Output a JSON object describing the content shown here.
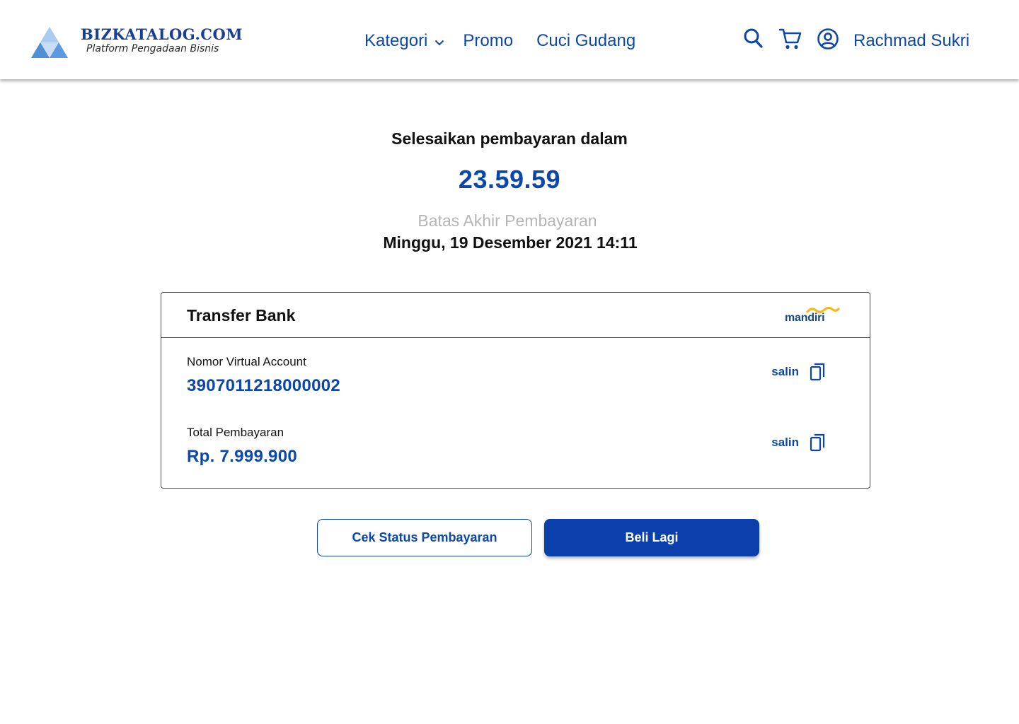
{
  "brand": {
    "name": "BIZKATALOG.COM",
    "tagline": "Platform Pengadaan Bisnis"
  },
  "nav": {
    "items": [
      {
        "label": "Kategori",
        "has_dropdown": true
      },
      {
        "label": "Promo"
      },
      {
        "label": "Cuci Gudang"
      }
    ]
  },
  "header": {
    "icons": [
      "search-icon",
      "cart-icon",
      "user-icon"
    ],
    "username": "Rachmad Sukri"
  },
  "payment": {
    "countdown_title": "Selesaikan pembayaran dalam",
    "timer": "23.59.59",
    "deadline_label": "Batas Akhir Pembayaran",
    "deadline_value": "Minggu, 19 Desember 2021 14:11",
    "method_title": "Transfer Bank",
    "bank_name": "mandiri",
    "va_label": "Nomor Virtual Account",
    "va_number": "3907011218000002",
    "total_label": "Total Pembayaran",
    "total_value": "Rp. 7.999.900",
    "copy_label": "salin"
  },
  "actions": {
    "check_status": "Cek Status Pembayaran",
    "buy_again": "Beli Lagi"
  },
  "colors": {
    "primary": "#0d47a9",
    "button_fill": "#0b3fac",
    "muted": "#b6b6b6",
    "bank_yellow": "#f6b81c"
  }
}
